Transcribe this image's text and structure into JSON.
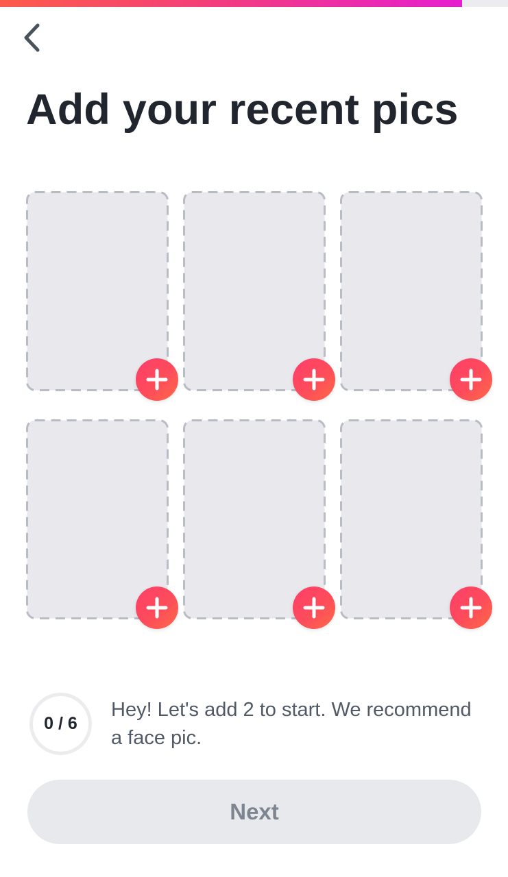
{
  "progress": {
    "fraction": 0.91,
    "gradient": [
      "#fd5c4a",
      "#f43d7a",
      "#e61ed0"
    ],
    "track_color": "#ececf0"
  },
  "header": {
    "back_icon": "chevron-left-icon"
  },
  "title": "Add your recent pics",
  "photo_slots": [
    {
      "slot": 1,
      "filled": false,
      "add_icon": "plus-icon"
    },
    {
      "slot": 2,
      "filled": false,
      "add_icon": "plus-icon"
    },
    {
      "slot": 3,
      "filled": false,
      "add_icon": "plus-icon"
    },
    {
      "slot": 4,
      "filled": false,
      "add_icon": "plus-icon"
    },
    {
      "slot": 5,
      "filled": false,
      "add_icon": "plus-icon"
    },
    {
      "slot": 6,
      "filled": false,
      "add_icon": "plus-icon"
    }
  ],
  "counter": {
    "text": "0 / 6",
    "added": 0,
    "total": 6
  },
  "hint": "Hey! Let's add 2 to start. We recommend a face pic.",
  "next_button": {
    "label": "Next",
    "enabled": false
  },
  "colors": {
    "accent": "#fd4c5a",
    "slot_fill": "#e9e9ed",
    "slot_border": "#b8bcc4",
    "title": "#21262e",
    "hint": "#505965",
    "button_bg": "#e8e9ed",
    "button_text": "#7d8591"
  }
}
